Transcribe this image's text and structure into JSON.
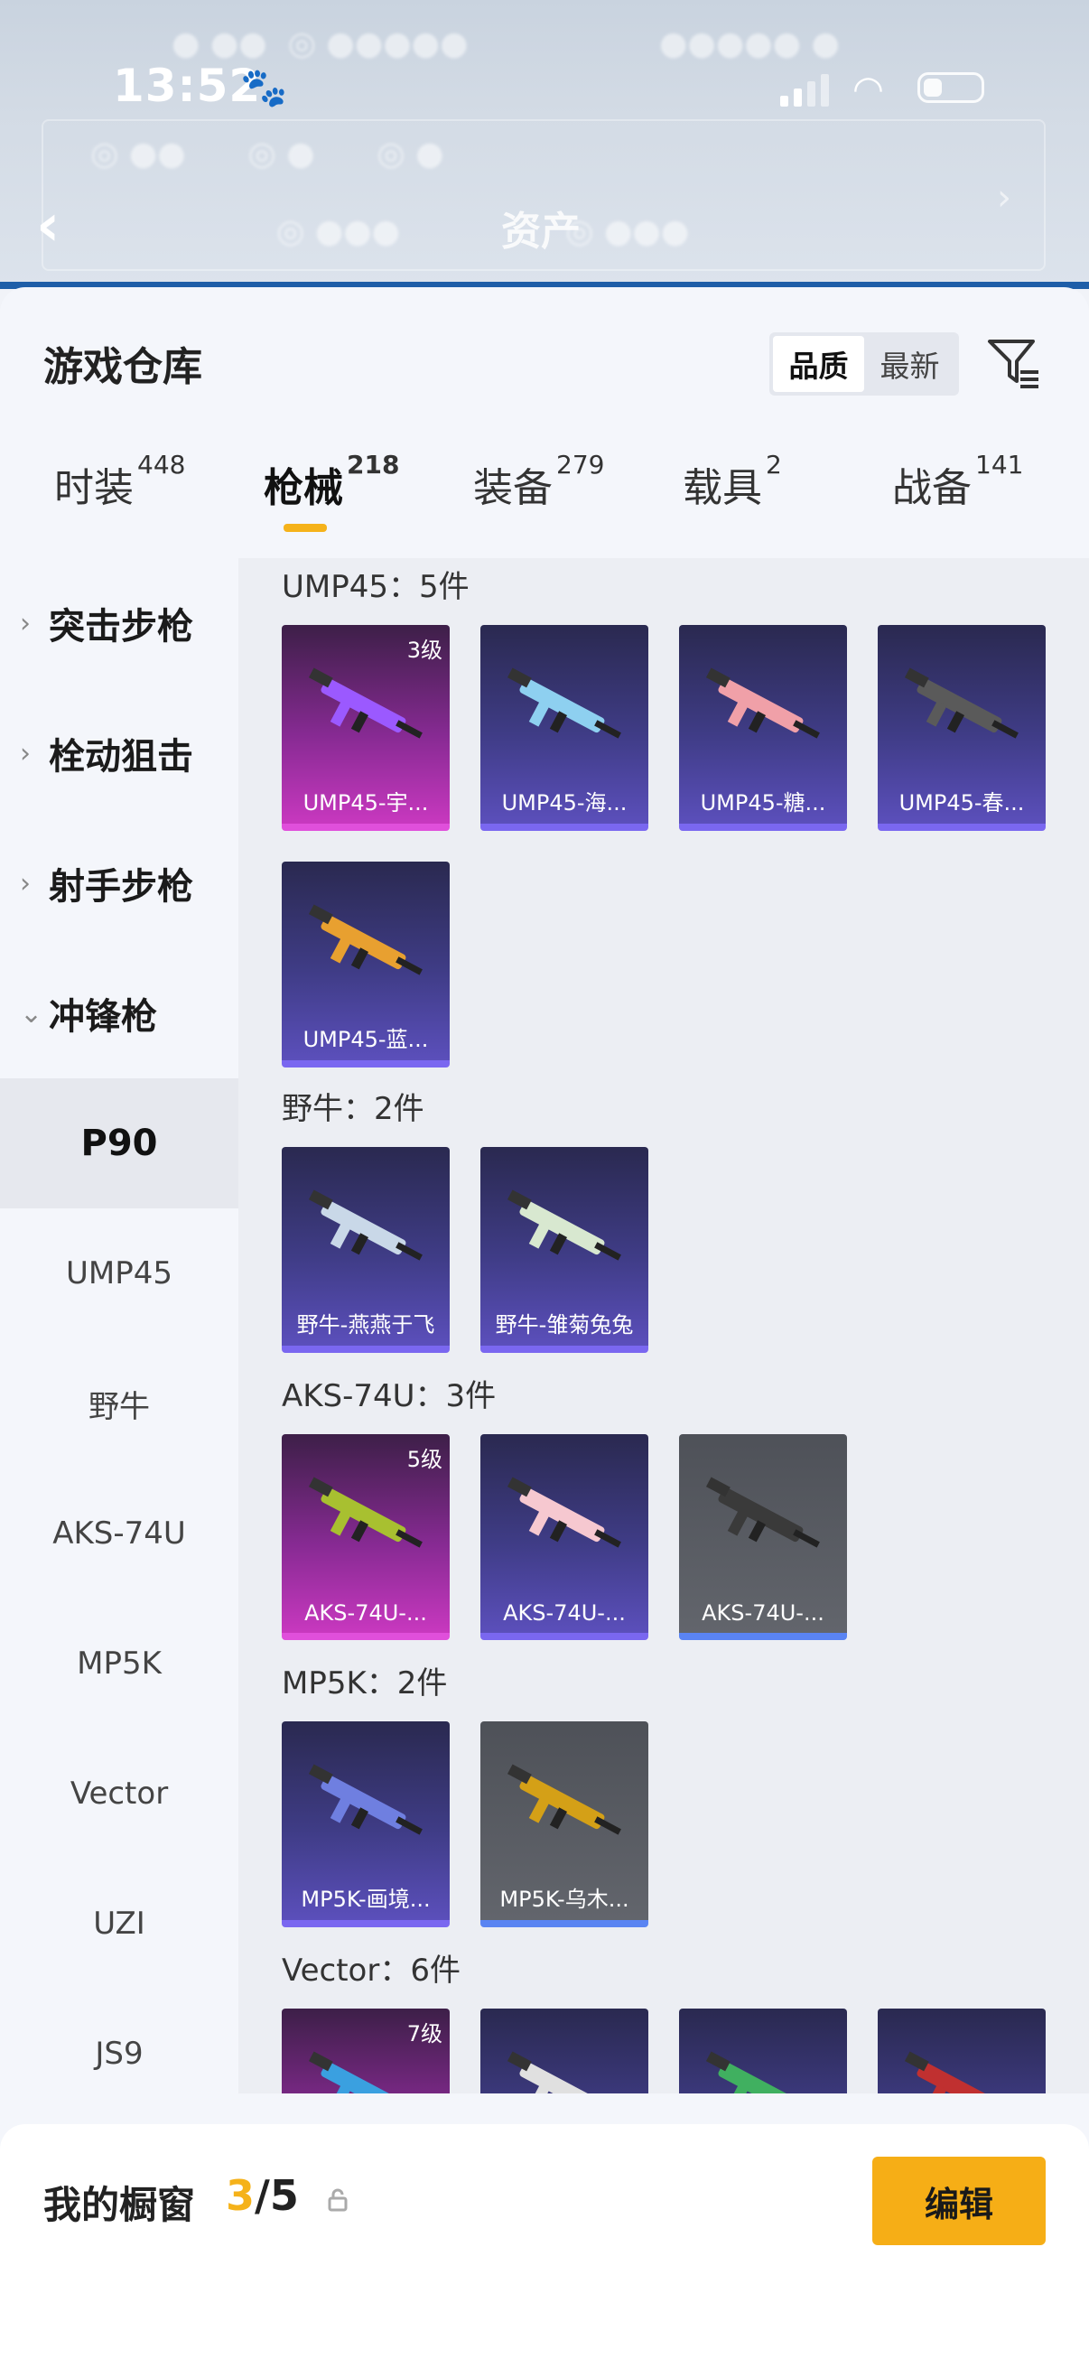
{
  "status": {
    "time": "13:52"
  },
  "header": {
    "title": "资产"
  },
  "sheet": {
    "title": "游戏仓库",
    "sort_options": [
      "品质",
      "最新"
    ],
    "sort_selected": "品质"
  },
  "tabs": [
    {
      "label": "时装",
      "count": "448"
    },
    {
      "label": "枪械",
      "count": "218"
    },
    {
      "label": "装备",
      "count": "279"
    },
    {
      "label": "载具",
      "count": "2"
    },
    {
      "label": "战备",
      "count": "141"
    }
  ],
  "sidebar": {
    "categories": [
      "突击步枪",
      "栓动狙击",
      "射手步枪",
      "冲锋枪"
    ],
    "subs": [
      "P90",
      "UMP45",
      "野牛",
      "AKS-74U",
      "MP5K",
      "Vector",
      "UZI",
      "JS9"
    ]
  },
  "groups": [
    {
      "title": "UMP45：5件",
      "items": [
        {
          "name": "UMP45-宇...",
          "level": "3级",
          "tier": "pink"
        },
        {
          "name": "UMP45-海...",
          "level": "",
          "tier": "purple"
        },
        {
          "name": "UMP45-糖...",
          "level": "",
          "tier": "purple"
        },
        {
          "name": "UMP45-春...",
          "level": "",
          "tier": "purple"
        },
        {
          "name": "UMP45-蓝...",
          "level": "",
          "tier": "purple"
        }
      ]
    },
    {
      "title": "野牛：2件",
      "items": [
        {
          "name": "野牛-燕燕于飞",
          "level": "",
          "tier": "purple"
        },
        {
          "name": "野牛-雏菊兔兔",
          "level": "",
          "tier": "purple"
        }
      ]
    },
    {
      "title": "AKS-74U：3件",
      "items": [
        {
          "name": "AKS-74U-...",
          "level": "5级",
          "tier": "pink"
        },
        {
          "name": "AKS-74U-...",
          "level": "",
          "tier": "purple"
        },
        {
          "name": "AKS-74U-...",
          "level": "",
          "tier": "gray"
        }
      ]
    },
    {
      "title": "MP5K：2件",
      "items": [
        {
          "name": "MP5K-画境...",
          "level": "",
          "tier": "purple"
        },
        {
          "name": "MP5K-乌木...",
          "level": "",
          "tier": "gray"
        }
      ]
    },
    {
      "title": "Vector：6件",
      "items": [
        {
          "name": "",
          "level": "7级",
          "tier": "pink"
        },
        {
          "name": "",
          "level": "",
          "tier": "purple"
        },
        {
          "name": "",
          "level": "",
          "tier": "purple"
        },
        {
          "name": "",
          "level": "",
          "tier": "purple"
        }
      ]
    }
  ],
  "showcase": {
    "label": "我的橱窗",
    "current": "3",
    "total": "/5",
    "edit_label": "编辑"
  },
  "colors": {
    "accent": "#f5b21a",
    "pink_tier": "#c838bf",
    "purple_tier": "#5b4fbb",
    "gray_tier": "#62656c"
  }
}
